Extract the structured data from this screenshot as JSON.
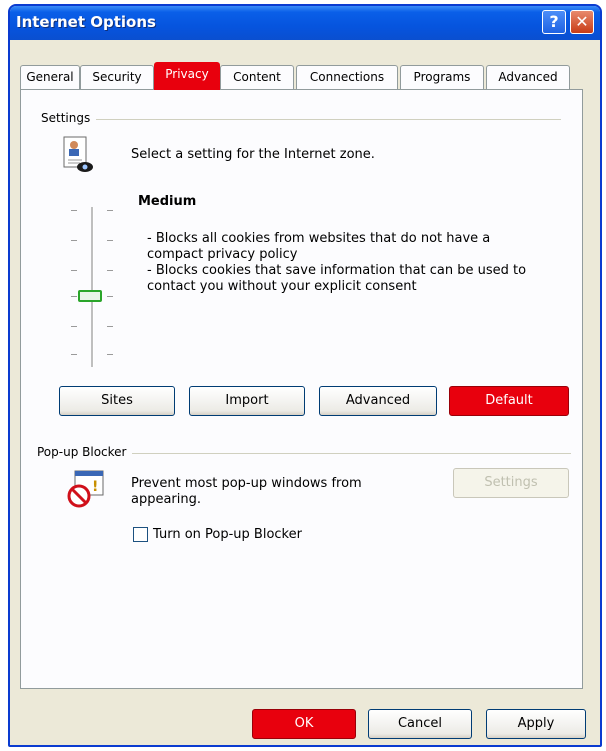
{
  "window": {
    "title": "Internet Options"
  },
  "titlebar": {
    "help_glyph": "?",
    "close_glyph": "✕"
  },
  "tabs": [
    {
      "label": "General"
    },
    {
      "label": "Security"
    },
    {
      "label": "Privacy",
      "active": true
    },
    {
      "label": "Content"
    },
    {
      "label": "Connections"
    },
    {
      "label": "Programs"
    },
    {
      "label": "Advanced"
    }
  ],
  "settings": {
    "group_label": "Settings",
    "zone_text": "Select a setting for the Internet zone.",
    "level_title": "Medium",
    "description": [
      "- Blocks all cookies from websites that do not have a",
      "compact privacy policy",
      "- Blocks cookies that save information that can be used to",
      "contact you without your explicit consent"
    ],
    "buttons": {
      "sites": "Sites",
      "import": "Import",
      "advanced": "Advanced",
      "default": "Default"
    }
  },
  "popup": {
    "group_label": "Pop-up Blocker",
    "text_line1": "Prevent most pop-up windows from",
    "text_line2": "appearing.",
    "settings_button": "Settings",
    "checkbox_label": "Turn on Pop-up Blocker",
    "checkbox_checked": false
  },
  "footer": {
    "ok": "OK",
    "cancel": "Cancel",
    "apply": "Apply"
  },
  "colors": {
    "accent": "#e8000d",
    "titlebar": "#0654de"
  },
  "icons": {
    "zone": "privacy-report-icon",
    "popup": "popup-blocker-icon"
  }
}
